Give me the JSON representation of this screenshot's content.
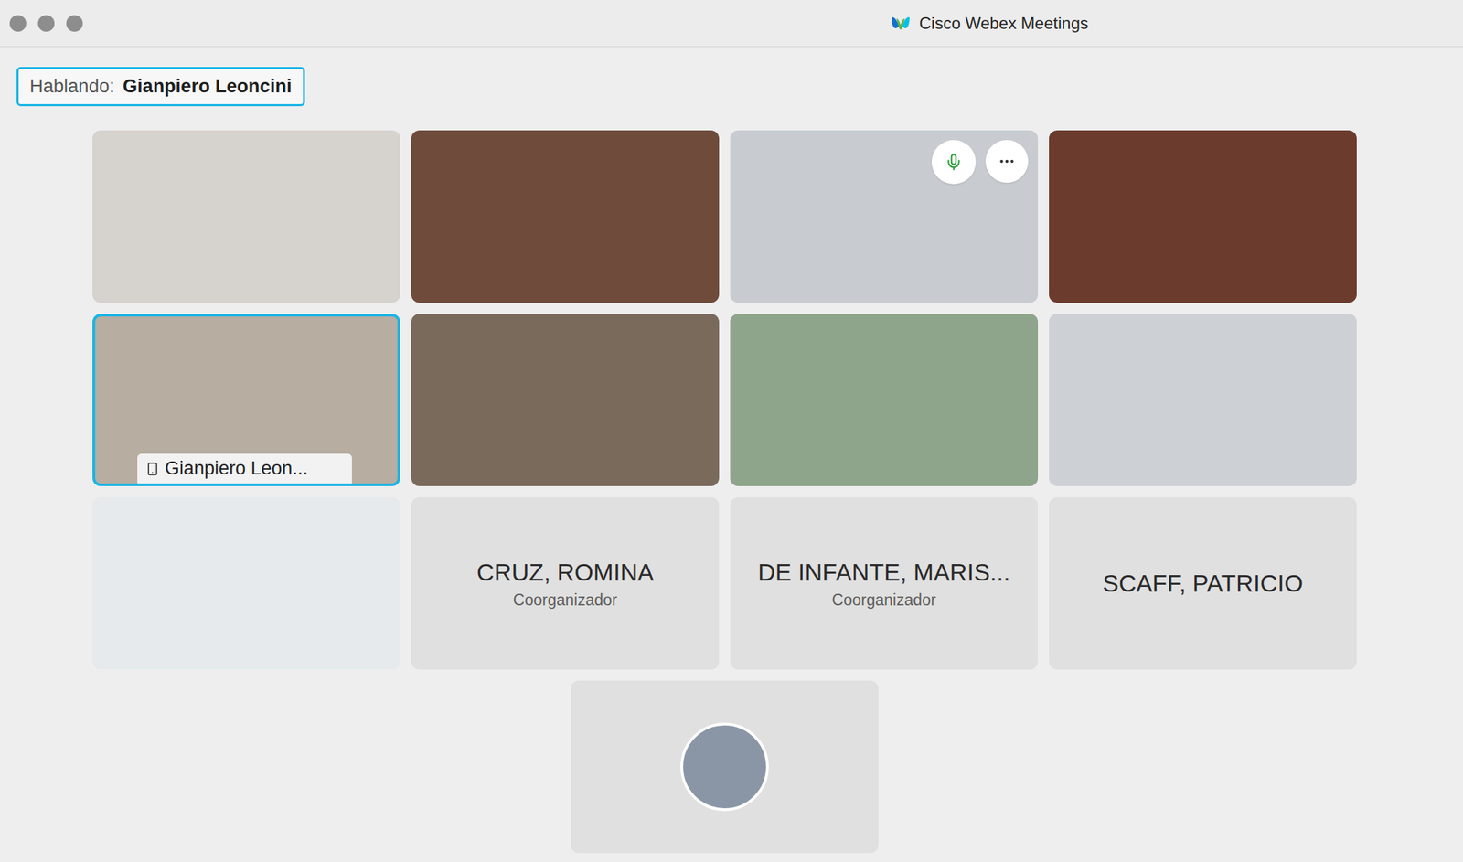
{
  "window": {
    "title": "Cisco Webex Meetings"
  },
  "speaking": {
    "label": "Hablando:",
    "name": "Gianpiero Leoncini"
  },
  "participants": [
    {
      "kind": "video",
      "color": "#d6d2ce",
      "active": false,
      "hover_controls": false
    },
    {
      "kind": "video",
      "color": "#6e4b3b",
      "active": false,
      "hover_controls": false
    },
    {
      "kind": "video",
      "color": "#c8ccd1",
      "active": false,
      "hover_controls": true
    },
    {
      "kind": "video",
      "color": "#6b3b2d",
      "active": false,
      "hover_controls": false
    },
    {
      "kind": "video",
      "color": "#b7ada1",
      "active": true,
      "hover_controls": false,
      "label": "Gianpiero Leon...",
      "device": "phone"
    },
    {
      "kind": "video",
      "color": "#7a6a5b",
      "active": false,
      "hover_controls": false
    },
    {
      "kind": "video",
      "color": "#8ea48b",
      "active": false,
      "hover_controls": false
    },
    {
      "kind": "video",
      "color": "#cdd0d4",
      "active": false,
      "hover_controls": false
    },
    {
      "kind": "video",
      "color": "#e6eaed",
      "active": false,
      "hover_controls": false
    },
    {
      "kind": "name",
      "name": "CRUZ, ROMINA",
      "role": "Coorganizador",
      "active": false,
      "hover_controls": false
    },
    {
      "kind": "name",
      "name": "DE INFANTE, MARIS...",
      "role": "Coorganizador",
      "active": false,
      "hover_controls": false
    },
    {
      "kind": "name",
      "name": "SCAFF, PATRICIO",
      "active": false,
      "hover_controls": false
    },
    {
      "kind": "avatar",
      "color": "#8a96a6",
      "active": false,
      "hover_controls": false
    }
  ]
}
